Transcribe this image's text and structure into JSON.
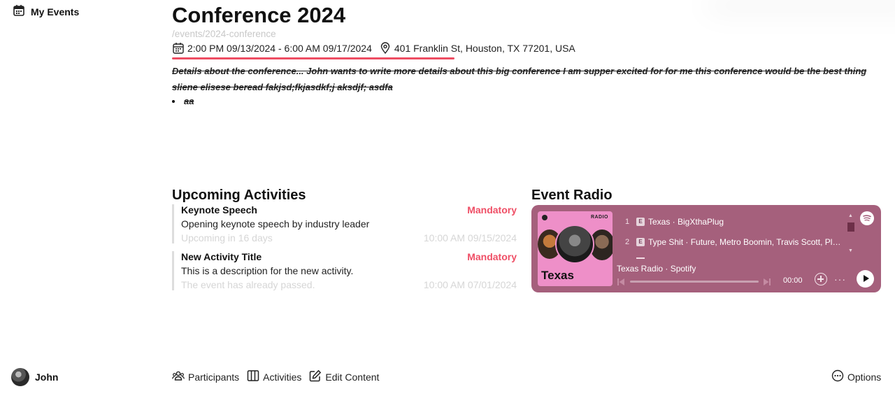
{
  "sidebar": {
    "my_events_label": "My Events",
    "user_name": "John"
  },
  "event": {
    "title": "Conference 2024",
    "slug": "/events/2024-conference",
    "datetime": "2:00 PM 09/13/2024 - 6:00 AM 09/17/2024",
    "location": "401 Franklin St, Houston, TX 77201, USA",
    "description": "Details about the conference... John wants to write more details about this big conference I am supper excited for for me this conference would be the best thing sliene elisese beread fakjsd;fkjasdkf;j aksdjf; asdfa",
    "bullet": "aa",
    "accent_color": "#ee4d63"
  },
  "activities": {
    "section_title": "Upcoming Activities",
    "items": [
      {
        "title": "Keynote Speech",
        "badge": "Mandatory",
        "description": "Opening keynote speech by industry leader",
        "status": "Upcoming in 16 days",
        "time": "10:00 AM 09/15/2024"
      },
      {
        "title": "New Activity Title",
        "badge": "Mandatory",
        "description": "This is a description for the new activity.",
        "status": "The event has already passed.",
        "time": "10:00 AM 07/01/2024"
      }
    ]
  },
  "radio": {
    "section_title": "Event Radio",
    "cover_label": "RADIO",
    "cover_title": "Texas",
    "subtitle": "Texas Radio · Spotify",
    "time": "00:00",
    "explicit_label": "E",
    "background_color": "#a5607c",
    "tracks": [
      {
        "num": "1",
        "name": "Texas · BigXthaPlug"
      },
      {
        "num": "2",
        "name": "Type Shit · Future, Metro Boomin, Travis Scott, Playboi Carti"
      }
    ]
  },
  "bottom_bar": {
    "participants": "Participants",
    "activities": "Activities",
    "edit_content": "Edit Content",
    "options": "Options"
  }
}
